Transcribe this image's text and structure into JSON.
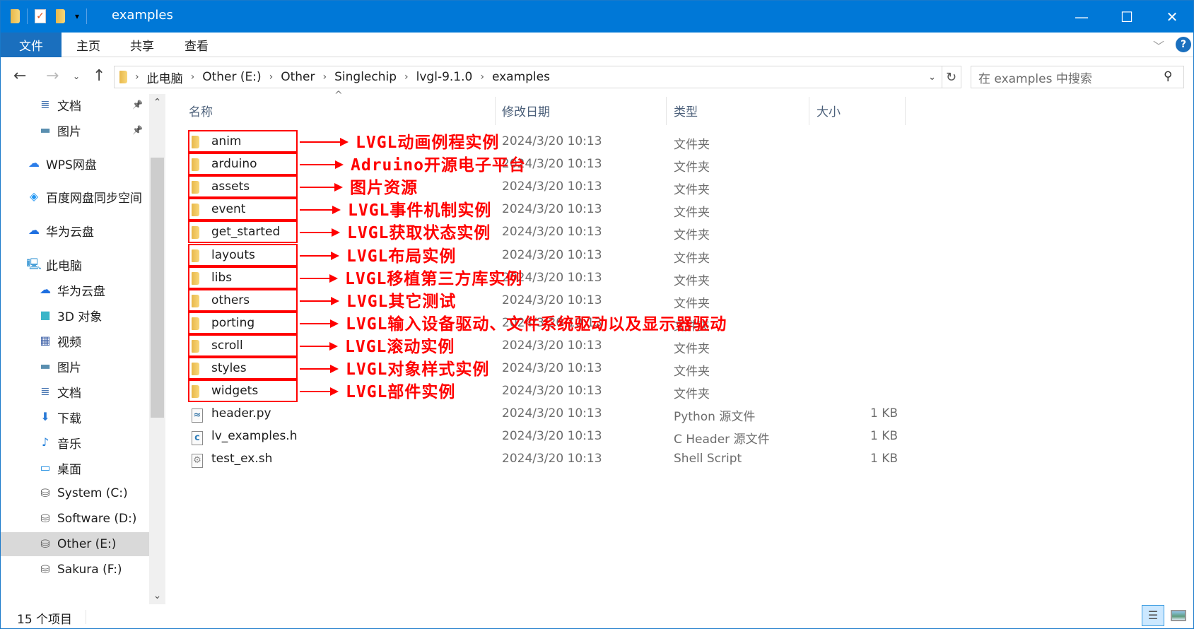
{
  "window": {
    "title": "examples",
    "controls": {
      "minimize": "—",
      "maximize": "☐",
      "close": "✕"
    }
  },
  "ribbon": {
    "tabs": [
      {
        "label": "文件",
        "active": true
      },
      {
        "label": "主页"
      },
      {
        "label": "共享"
      },
      {
        "label": "查看"
      }
    ],
    "help": "?"
  },
  "address": {
    "breadcrumb": [
      "此电脑",
      "Other (E:)",
      "Other",
      "Singlechip",
      "lvgl-9.1.0",
      "examples"
    ],
    "search_placeholder": "在 examples 中搜索"
  },
  "sidebar": {
    "items": [
      {
        "label": "文档",
        "icon": "document-icon",
        "pinned": true
      },
      {
        "label": "图片",
        "icon": "picture-icon",
        "pinned": true
      },
      {
        "label": "WPS网盘",
        "icon": "cloud-outline-icon"
      },
      {
        "label": "百度网盘同步空间",
        "icon": "baidu-netdisk-icon"
      },
      {
        "label": "华为云盘",
        "icon": "huawei-cloud-icon"
      },
      {
        "label": "此电脑",
        "icon": "computer-icon"
      },
      {
        "label": "华为云盘",
        "icon": "huawei-cloud-icon"
      },
      {
        "label": "3D 对象",
        "icon": "3d-objects-icon"
      },
      {
        "label": "视频",
        "icon": "video-icon"
      },
      {
        "label": "图片",
        "icon": "picture-icon"
      },
      {
        "label": "文档",
        "icon": "document-icon"
      },
      {
        "label": "下载",
        "icon": "download-icon"
      },
      {
        "label": "音乐",
        "icon": "music-icon"
      },
      {
        "label": "桌面",
        "icon": "desktop-icon"
      },
      {
        "label": "System (C:)",
        "icon": "system-drive-icon"
      },
      {
        "label": "Software (D:)",
        "icon": "drive-icon"
      },
      {
        "label": "Other (E:)",
        "icon": "drive-icon",
        "selected": true
      },
      {
        "label": "Sakura (F:)",
        "icon": "drive-icon"
      }
    ]
  },
  "columns": {
    "name": "名称",
    "date": "修改日期",
    "type": "类型",
    "size": "大小"
  },
  "files": [
    {
      "name": "anim",
      "date": "2024/3/20 10:13",
      "type": "文件夹",
      "size": "",
      "kind": "folder"
    },
    {
      "name": "arduino",
      "date": "2024/3/20 10:13",
      "type": "文件夹",
      "size": "",
      "kind": "folder"
    },
    {
      "name": "assets",
      "date": "2024/3/20 10:13",
      "type": "文件夹",
      "size": "",
      "kind": "folder"
    },
    {
      "name": "event",
      "date": "2024/3/20 10:13",
      "type": "文件夹",
      "size": "",
      "kind": "folder"
    },
    {
      "name": "get_started",
      "date": "2024/3/20 10:13",
      "type": "文件夹",
      "size": "",
      "kind": "folder"
    },
    {
      "name": "layouts",
      "date": "2024/3/20 10:13",
      "type": "文件夹",
      "size": "",
      "kind": "folder"
    },
    {
      "name": "libs",
      "date": "2024/3/20 10:13",
      "type": "文件夹",
      "size": "",
      "kind": "folder"
    },
    {
      "name": "others",
      "date": "2024/3/20 10:13",
      "type": "文件夹",
      "size": "",
      "kind": "folder"
    },
    {
      "name": "porting",
      "date": "2024/3/20 10:13",
      "type": "文件夹",
      "size": "",
      "kind": "folder"
    },
    {
      "name": "scroll",
      "date": "2024/3/20 10:13",
      "type": "文件夹",
      "size": "",
      "kind": "folder"
    },
    {
      "name": "styles",
      "date": "2024/3/20 10:13",
      "type": "文件夹",
      "size": "",
      "kind": "folder"
    },
    {
      "name": "widgets",
      "date": "2024/3/20 10:13",
      "type": "文件夹",
      "size": "",
      "kind": "folder"
    },
    {
      "name": "header.py",
      "date": "2024/3/20 10:13",
      "type": "Python 源文件",
      "size": "1 KB",
      "kind": "python"
    },
    {
      "name": "lv_examples.h",
      "date": "2024/3/20 10:13",
      "type": "C Header 源文件",
      "size": "1 KB",
      "kind": "cheader"
    },
    {
      "name": "test_ex.sh",
      "date": "2024/3/20 10:13",
      "type": "Shell Script",
      "size": "1 KB",
      "kind": "shell"
    }
  ],
  "annotations": [
    "LVGL动画例程实例",
    "Adruino开源电子平台",
    "图片资源",
    "LVGL事件机制实例",
    "LVGL获取状态实例",
    "LVGL布局实例",
    "LVGL移植第三方库实例",
    "LVGL其它测试",
    "LVGL输入设备驱动、文件系统驱动以及显示器驱动",
    "LVGL滚动实例",
    "LVGL对象样式实例",
    "LVGL部件实例"
  ],
  "annotation_color": "#ff0000",
  "status": {
    "item_count": "15 个项目"
  },
  "colors": {
    "titlebar": "#0078d7",
    "file_tab": "#1a6fbe",
    "selected_nav": "#d9d9d9"
  }
}
